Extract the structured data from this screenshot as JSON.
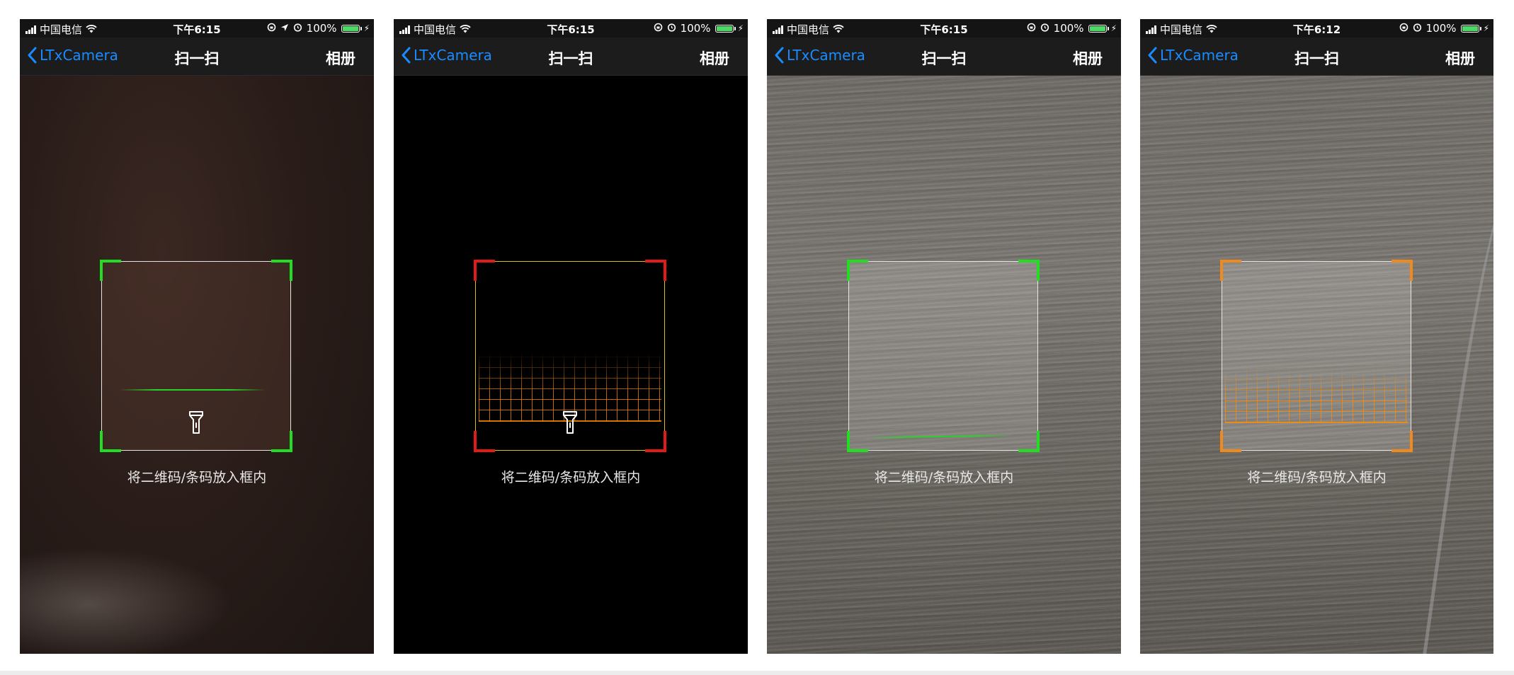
{
  "colors": {
    "nav_link": "#1a8cff",
    "battery": "#4cd964",
    "corner_green": "#22dd22",
    "corner_red": "#e21a1a",
    "corner_orange": "#f08a1c",
    "frame_yellow": "#d8c21a"
  },
  "screens": [
    {
      "status": {
        "carrier": "中国电信",
        "time": "下午6:15",
        "battery": "100%"
      },
      "nav": {
        "back_label": "LTxCamera",
        "title": "扫一扫",
        "right_label": "相册"
      },
      "hint": "将二维码/条码放入框内",
      "corner_color": "green",
      "scan_style": "line",
      "torch_icon": "flashlight-icon"
    },
    {
      "status": {
        "carrier": "中国电信",
        "time": "下午6:15",
        "battery": "100%"
      },
      "nav": {
        "back_label": "LTxCamera",
        "title": "扫一扫",
        "right_label": "相册"
      },
      "hint": "将二维码/条码放入框内",
      "corner_color": "red",
      "scan_style": "grid",
      "torch_icon": "flashlight-icon"
    },
    {
      "status": {
        "carrier": "中国电信",
        "time": "下午6:15",
        "battery": "100%"
      },
      "nav": {
        "back_label": "LTxCamera",
        "title": "扫一扫",
        "right_label": "相册"
      },
      "hint": "将二维码/条码放入框内",
      "corner_color": "green",
      "scan_style": "line"
    },
    {
      "status": {
        "carrier": "中国电信",
        "time": "下午6:12",
        "battery": "100%"
      },
      "nav": {
        "back_label": "LTxCamera",
        "title": "扫一扫",
        "right_label": "相册"
      },
      "hint": "将二维码/条码放入框内",
      "corner_color": "orange",
      "scan_style": "grid"
    }
  ]
}
